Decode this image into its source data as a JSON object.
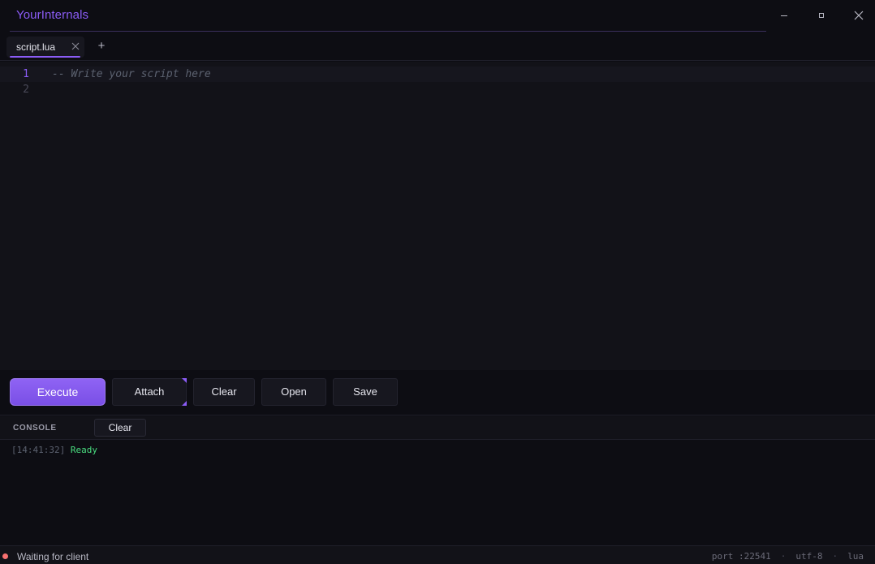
{
  "app": {
    "title": "YourInternals"
  },
  "window_controls": {
    "minimize_icon": "minimize-icon",
    "maximize_icon": "maximize-icon",
    "close_icon": "close-icon"
  },
  "tabs": [
    {
      "label": "script.lua",
      "active": true
    }
  ],
  "tab_add_label": "+",
  "editor": {
    "lines": [
      {
        "number": "1",
        "code": "-- Write your script here"
      },
      {
        "number": "2",
        "code": ""
      }
    ]
  },
  "toolbar": {
    "execute_label": "Execute",
    "attach_label": "Attach",
    "clear_label": "Clear",
    "open_label": "Open",
    "save_label": "Save"
  },
  "console": {
    "label": "CONSOLE",
    "clear_label": "Clear",
    "logs": [
      {
        "time": "[14:41:32]",
        "message": "Ready"
      }
    ]
  },
  "statusbar": {
    "status_text": "Waiting for client",
    "status_color": "#f87171",
    "port": "port :22541",
    "encoding": "utf-8",
    "language": "lua"
  },
  "colors": {
    "accent": "#8b5cf6",
    "success": "#4ade80",
    "background": "#0d0d13"
  }
}
